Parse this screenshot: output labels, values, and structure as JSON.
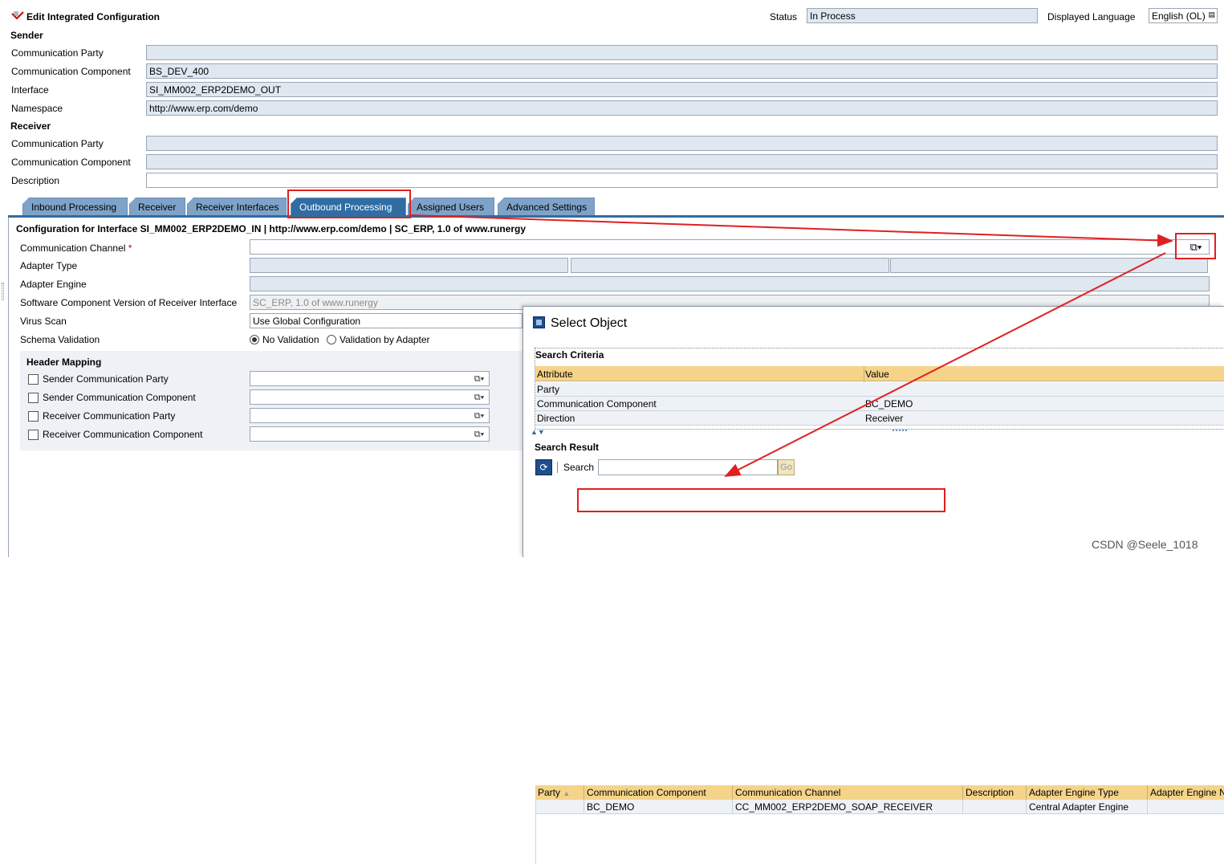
{
  "title": "Edit Integrated Configuration",
  "status": {
    "label": "Status",
    "value": "In Process"
  },
  "language": {
    "label": "Displayed Language",
    "value": "English (OL)"
  },
  "sender": {
    "heading": "Sender",
    "party_label": "Communication Party",
    "party_value": "",
    "component_label": "Communication Component",
    "component_value": "BS_DEV_400",
    "interface_label": "Interface",
    "interface_value": "SI_MM002_ERP2DEMO_OUT",
    "namespace_label": "Namespace",
    "namespace_value": "http://www.erp.com/demo"
  },
  "receiver": {
    "heading": "Receiver",
    "party_label": "Communication Party",
    "party_value": "",
    "component_label": "Communication Component",
    "component_value": ""
  },
  "description": {
    "label": "Description",
    "value": ""
  },
  "tabs": [
    {
      "label": "Inbound Processing"
    },
    {
      "label": "Receiver"
    },
    {
      "label": "Receiver Interfaces"
    },
    {
      "label": "Outbound Processing"
    },
    {
      "label": "Assigned Users"
    },
    {
      "label": "Advanced Settings"
    }
  ],
  "outbound": {
    "config_title": "Configuration for Interface SI_MM002_ERP2DEMO_IN | http://www.erp.com/demo | SC_ERP, 1.0 of www.runergy",
    "channel_label": "Communication Channel",
    "required_mark": "*",
    "adapter_type_label": "Adapter Type",
    "adapter_engine_label": "Adapter Engine",
    "swcv_label": "Software Component Version of Receiver Interface",
    "swcv_value": "SC_ERP, 1.0 of www.runergy",
    "virus_label": "Virus Scan",
    "virus_value": "Use Global Configuration",
    "schema_label": "Schema Validation",
    "schema_opt1": "No Validation",
    "schema_opt2": "Validation by Adapter",
    "header_mapping": "Header Mapping",
    "hm_items": [
      {
        "label": "Sender Communication Party"
      },
      {
        "label": "Sender Communication Component"
      },
      {
        "label": "Receiver Communication Party"
      },
      {
        "label": "Receiver Communication Component"
      }
    ]
  },
  "dialog": {
    "title": "Select Object",
    "criteria_heading": "Search Criteria",
    "col_attribute": "Attribute",
    "col_value": "Value",
    "criteria_rows": [
      {
        "attr": "Party",
        "value": ""
      },
      {
        "attr": "Communication Component",
        "value": "BC_DEMO"
      },
      {
        "attr": "Direction",
        "value": "Receiver"
      }
    ],
    "result_heading": "Search Result",
    "search_label": "Search",
    "go_label": "Go",
    "columns": [
      "Party",
      "Communication Component",
      "Communication Channel",
      "Description",
      "Adapter Engine Type",
      "Adapter Engine N"
    ],
    "row": [
      "",
      "BC_DEMO",
      "CC_MM002_ERP2DEMO_SOAP_RECEIVER",
      "",
      "Central Adapter Engine",
      ""
    ]
  },
  "watermark": "CSDN @Seele_1018",
  "colors": {
    "annotation": "#e02020",
    "tab_active": "#2f6da3",
    "tab": "#7fa3c8",
    "field": "#dfe8f1"
  }
}
